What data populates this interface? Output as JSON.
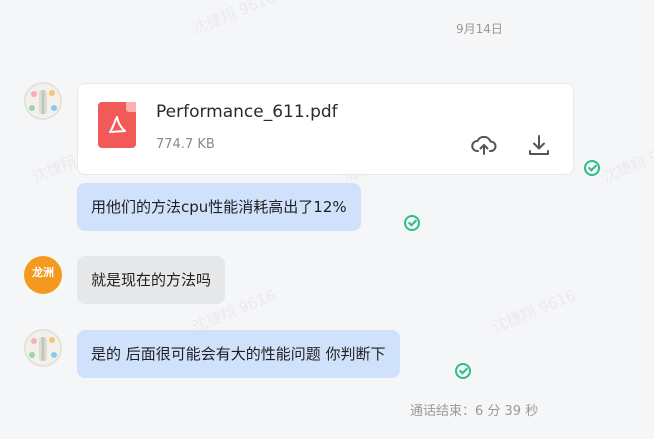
{
  "watermark": "沈捷翔 9616",
  "date_separator": "9月14日",
  "file_message": {
    "name": "Performance_611.pdf",
    "size": "774.7 KB",
    "file_icon": "pdf-file-icon",
    "actions": [
      "cloud-upload-icon",
      "download-icon"
    ]
  },
  "messages": [
    {
      "sender_avatar": "avatar-photo",
      "text": "用他们的方法cpu性能消耗高出了12%",
      "underlined": "cpu",
      "status": "read-check-icon"
    },
    {
      "sender_avatar": "avatar-longzhou",
      "avatar_label": "龙洲",
      "text": "就是现在的方法吗"
    },
    {
      "sender_avatar": "avatar-photo",
      "text": "是的 后面很可能会有大的性能问题 你判断下",
      "status": "read-check-icon"
    }
  ],
  "call_status": "通话结束：6 分 39 秒",
  "colors": {
    "sent_bubble": "#d0e2fb",
    "received_bubble": "#e7e8ea",
    "check": "#2dbd86",
    "pdf": "#f25a5a"
  }
}
